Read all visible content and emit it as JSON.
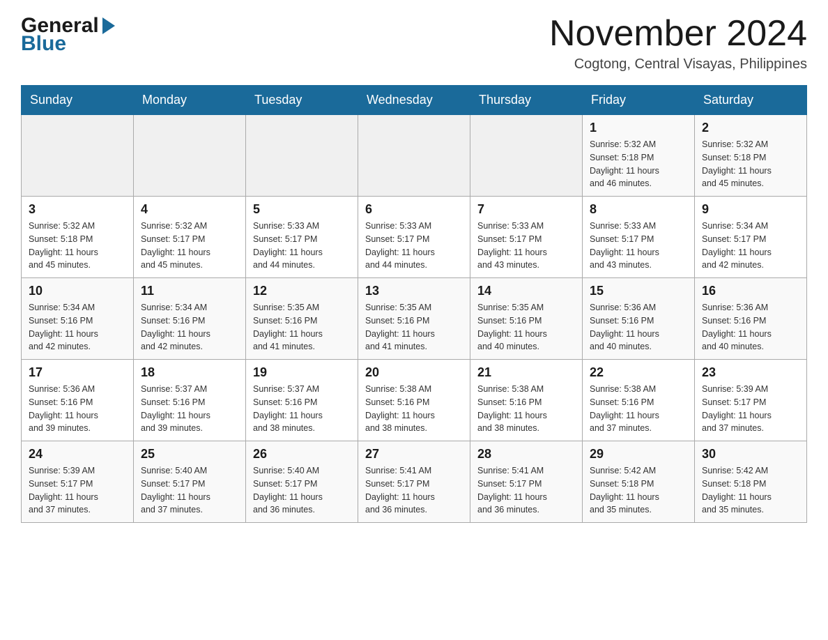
{
  "header": {
    "title": "November 2024",
    "subtitle": "Cogtong, Central Visayas, Philippines",
    "logo_general": "General",
    "logo_blue": "Blue"
  },
  "days_of_week": [
    "Sunday",
    "Monday",
    "Tuesday",
    "Wednesday",
    "Thursday",
    "Friday",
    "Saturday"
  ],
  "weeks": [
    [
      {
        "day": "",
        "info": ""
      },
      {
        "day": "",
        "info": ""
      },
      {
        "day": "",
        "info": ""
      },
      {
        "day": "",
        "info": ""
      },
      {
        "day": "",
        "info": ""
      },
      {
        "day": "1",
        "info": "Sunrise: 5:32 AM\nSunset: 5:18 PM\nDaylight: 11 hours\nand 46 minutes."
      },
      {
        "day": "2",
        "info": "Sunrise: 5:32 AM\nSunset: 5:18 PM\nDaylight: 11 hours\nand 45 minutes."
      }
    ],
    [
      {
        "day": "3",
        "info": "Sunrise: 5:32 AM\nSunset: 5:18 PM\nDaylight: 11 hours\nand 45 minutes."
      },
      {
        "day": "4",
        "info": "Sunrise: 5:32 AM\nSunset: 5:17 PM\nDaylight: 11 hours\nand 45 minutes."
      },
      {
        "day": "5",
        "info": "Sunrise: 5:33 AM\nSunset: 5:17 PM\nDaylight: 11 hours\nand 44 minutes."
      },
      {
        "day": "6",
        "info": "Sunrise: 5:33 AM\nSunset: 5:17 PM\nDaylight: 11 hours\nand 44 minutes."
      },
      {
        "day": "7",
        "info": "Sunrise: 5:33 AM\nSunset: 5:17 PM\nDaylight: 11 hours\nand 43 minutes."
      },
      {
        "day": "8",
        "info": "Sunrise: 5:33 AM\nSunset: 5:17 PM\nDaylight: 11 hours\nand 43 minutes."
      },
      {
        "day": "9",
        "info": "Sunrise: 5:34 AM\nSunset: 5:17 PM\nDaylight: 11 hours\nand 42 minutes."
      }
    ],
    [
      {
        "day": "10",
        "info": "Sunrise: 5:34 AM\nSunset: 5:16 PM\nDaylight: 11 hours\nand 42 minutes."
      },
      {
        "day": "11",
        "info": "Sunrise: 5:34 AM\nSunset: 5:16 PM\nDaylight: 11 hours\nand 42 minutes."
      },
      {
        "day": "12",
        "info": "Sunrise: 5:35 AM\nSunset: 5:16 PM\nDaylight: 11 hours\nand 41 minutes."
      },
      {
        "day": "13",
        "info": "Sunrise: 5:35 AM\nSunset: 5:16 PM\nDaylight: 11 hours\nand 41 minutes."
      },
      {
        "day": "14",
        "info": "Sunrise: 5:35 AM\nSunset: 5:16 PM\nDaylight: 11 hours\nand 40 minutes."
      },
      {
        "day": "15",
        "info": "Sunrise: 5:36 AM\nSunset: 5:16 PM\nDaylight: 11 hours\nand 40 minutes."
      },
      {
        "day": "16",
        "info": "Sunrise: 5:36 AM\nSunset: 5:16 PM\nDaylight: 11 hours\nand 40 minutes."
      }
    ],
    [
      {
        "day": "17",
        "info": "Sunrise: 5:36 AM\nSunset: 5:16 PM\nDaylight: 11 hours\nand 39 minutes."
      },
      {
        "day": "18",
        "info": "Sunrise: 5:37 AM\nSunset: 5:16 PM\nDaylight: 11 hours\nand 39 minutes."
      },
      {
        "day": "19",
        "info": "Sunrise: 5:37 AM\nSunset: 5:16 PM\nDaylight: 11 hours\nand 38 minutes."
      },
      {
        "day": "20",
        "info": "Sunrise: 5:38 AM\nSunset: 5:16 PM\nDaylight: 11 hours\nand 38 minutes."
      },
      {
        "day": "21",
        "info": "Sunrise: 5:38 AM\nSunset: 5:16 PM\nDaylight: 11 hours\nand 38 minutes."
      },
      {
        "day": "22",
        "info": "Sunrise: 5:38 AM\nSunset: 5:16 PM\nDaylight: 11 hours\nand 37 minutes."
      },
      {
        "day": "23",
        "info": "Sunrise: 5:39 AM\nSunset: 5:17 PM\nDaylight: 11 hours\nand 37 minutes."
      }
    ],
    [
      {
        "day": "24",
        "info": "Sunrise: 5:39 AM\nSunset: 5:17 PM\nDaylight: 11 hours\nand 37 minutes."
      },
      {
        "day": "25",
        "info": "Sunrise: 5:40 AM\nSunset: 5:17 PM\nDaylight: 11 hours\nand 37 minutes."
      },
      {
        "day": "26",
        "info": "Sunrise: 5:40 AM\nSunset: 5:17 PM\nDaylight: 11 hours\nand 36 minutes."
      },
      {
        "day": "27",
        "info": "Sunrise: 5:41 AM\nSunset: 5:17 PM\nDaylight: 11 hours\nand 36 minutes."
      },
      {
        "day": "28",
        "info": "Sunrise: 5:41 AM\nSunset: 5:17 PM\nDaylight: 11 hours\nand 36 minutes."
      },
      {
        "day": "29",
        "info": "Sunrise: 5:42 AM\nSunset: 5:18 PM\nDaylight: 11 hours\nand 35 minutes."
      },
      {
        "day": "30",
        "info": "Sunrise: 5:42 AM\nSunset: 5:18 PM\nDaylight: 11 hours\nand 35 minutes."
      }
    ]
  ]
}
